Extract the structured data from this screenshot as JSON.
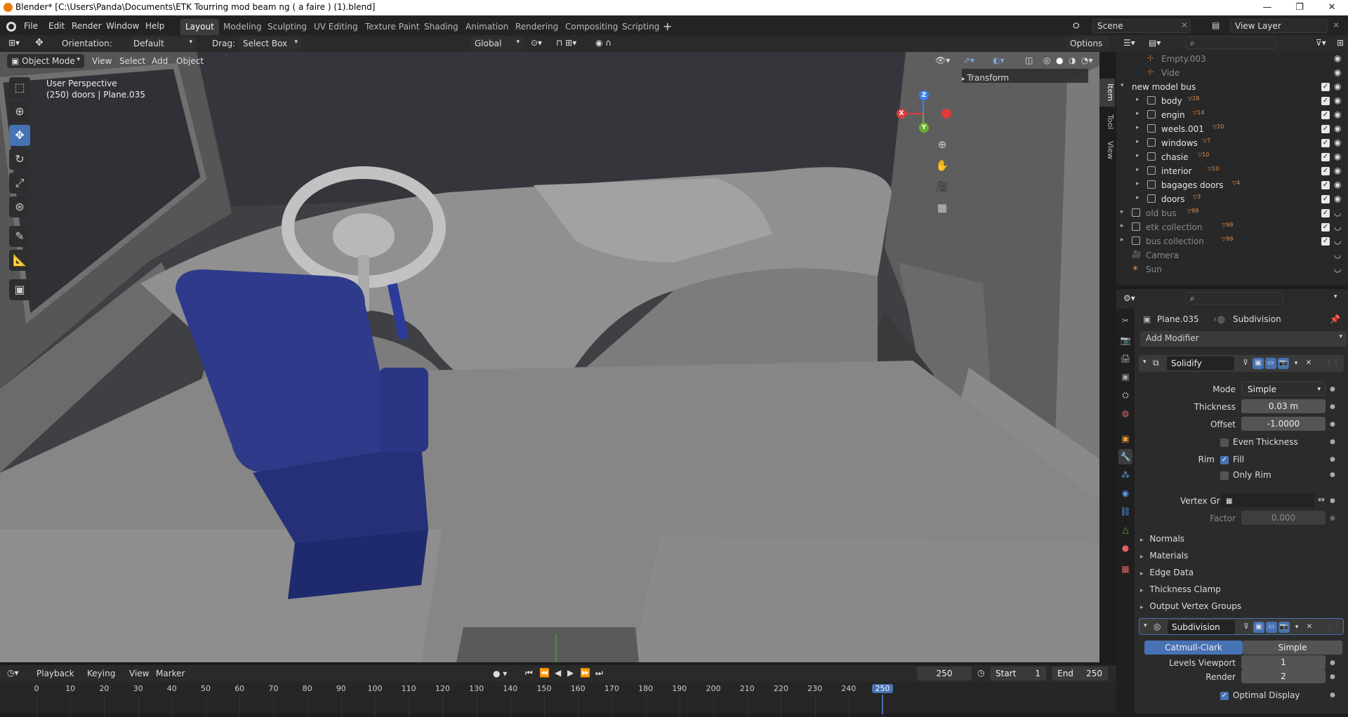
{
  "window": {
    "title": "Blender* [C:\\Users\\Panda\\Documents\\ETK Tourring mod beam ng ( a faire ) (1).blend]",
    "minimize": "—",
    "maximize": "❐",
    "close": "✕"
  },
  "menus": [
    "File",
    "Edit",
    "Render",
    "Window",
    "Help"
  ],
  "workspaces": [
    "Layout",
    "Modeling",
    "Sculpting",
    "UV Editing",
    "Texture Paint",
    "Shading",
    "Animation",
    "Rendering",
    "Compositing",
    "Scripting"
  ],
  "active_workspace": "Layout",
  "scene": {
    "name": "Scene",
    "view_layer": "View Layer"
  },
  "tool_header": {
    "orientation_label": "Orientation:",
    "orientation_value": "Default",
    "drag_label": "Drag:",
    "drag_value": "Select Box",
    "transform_orientation": "Global",
    "options": "Options"
  },
  "view_header": {
    "mode": "Object Mode",
    "items": [
      "View",
      "Select",
      "Add",
      "Object"
    ]
  },
  "viewport": {
    "perspective": "User Perspective",
    "info": "(250) doors | Plane.035",
    "sidebar_panel": "Transform",
    "sidebar_tabs": [
      "Item",
      "Tool",
      "View"
    ],
    "gizmo": {
      "x": "X",
      "y": "Y",
      "z": "Z"
    }
  },
  "outliner": {
    "rows": [
      {
        "name": "Empty.003",
        "indent": 2,
        "dim": true,
        "kind": "empty"
      },
      {
        "name": "Vide",
        "indent": 2,
        "dim": true,
        "kind": "empty"
      },
      {
        "name": "new model bus",
        "indent": 1,
        "dim": false,
        "kind": "collection",
        "expanded": true
      },
      {
        "name": "body",
        "indent": 2,
        "dim": false,
        "kind": "collection",
        "badge": "28"
      },
      {
        "name": "engin",
        "indent": 2,
        "dim": false,
        "kind": "collection",
        "badge": "14"
      },
      {
        "name": "weels.001",
        "indent": 2,
        "dim": false,
        "kind": "collection",
        "badge": "20"
      },
      {
        "name": "windows",
        "indent": 2,
        "dim": false,
        "kind": "collection",
        "badge": "7"
      },
      {
        "name": "chasie",
        "indent": 2,
        "dim": false,
        "kind": "collection",
        "badge": "10"
      },
      {
        "name": "interior",
        "indent": 2,
        "dim": false,
        "kind": "collection",
        "badge": "10"
      },
      {
        "name": "bagages doors",
        "indent": 2,
        "dim": false,
        "kind": "collection",
        "badge": "4"
      },
      {
        "name": "doors",
        "indent": 2,
        "dim": false,
        "kind": "collection",
        "badge": "3"
      },
      {
        "name": "old bus",
        "indent": 1,
        "dim": true,
        "kind": "collection",
        "badge": "99"
      },
      {
        "name": "etk collection",
        "indent": 1,
        "dim": true,
        "kind": "collection",
        "badge": "99"
      },
      {
        "name": "bus collection",
        "indent": 1,
        "dim": true,
        "kind": "collection",
        "badge": "99"
      },
      {
        "name": "Camera",
        "indent": 1,
        "dim": true,
        "kind": "camera"
      },
      {
        "name": "Sun",
        "indent": 1,
        "dim": true,
        "kind": "light"
      }
    ]
  },
  "properties": {
    "object": "Plane.035",
    "modifier_context": "Subdivision",
    "add_modifier": "Add Modifier",
    "solidify": {
      "name": "Solidify",
      "mode_label": "Mode",
      "mode_value": "Simple",
      "thickness_label": "Thickness",
      "thickness_value": "0.03 m",
      "offset_label": "Offset",
      "offset_value": "-1.0000",
      "even_thickness": "Even Thickness",
      "rim_label": "Rim",
      "fill": "Fill",
      "only_rim": "Only Rim",
      "vertex_group_label": "Vertex Group",
      "factor_label": "Factor",
      "factor_value": "0.000",
      "subpanels": [
        "Normals",
        "Materials",
        "Edge Data",
        "Thickness Clamp",
        "Output Vertex Groups"
      ]
    },
    "subdivision": {
      "name": "Subdivision",
      "type_active": "Catmull-Clark",
      "type_other": "Simple",
      "levels_viewport_label": "Levels Viewport",
      "levels_viewport_value": "1",
      "render_label": "Render",
      "render_value": "2",
      "optimal_display": "Optimal Display"
    }
  },
  "timeline": {
    "menus": [
      "Playback",
      "Keying",
      "View",
      "Marker"
    ],
    "current_frame": "250",
    "start_label": "Start",
    "start_value": "1",
    "end_label": "End",
    "end_value": "250",
    "ticks": [
      "0",
      "10",
      "20",
      "30",
      "40",
      "50",
      "60",
      "70",
      "80",
      "90",
      "100",
      "110",
      "120",
      "130",
      "140",
      "150",
      "160",
      "170",
      "180",
      "190",
      "200",
      "210",
      "220",
      "230",
      "240",
      "250"
    ]
  },
  "colors": {
    "accent": "#4772b3",
    "seat": "#2f3a86",
    "orange": "#e87d0d"
  }
}
